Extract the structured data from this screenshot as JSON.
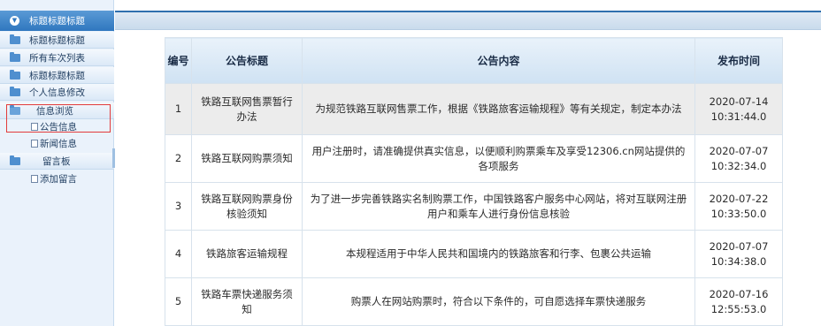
{
  "sidebar": {
    "header_label": "标题标题标题",
    "items": [
      {
        "label": "标题标题标题"
      },
      {
        "label": "所有车次列表"
      },
      {
        "label": "标题标题标题"
      },
      {
        "label": "个人信息修改"
      },
      {
        "label": "信息浏览"
      }
    ],
    "info_sub": [
      {
        "label": "公告信息"
      },
      {
        "label": "新闻信息"
      }
    ],
    "msg_folder": {
      "label": "留言板"
    },
    "msg_sub": [
      {
        "label": "添加留言"
      }
    ]
  },
  "table": {
    "headers": [
      "编号",
      "公告标题",
      "公告内容",
      "发布时间"
    ],
    "rows": [
      {
        "id": "1",
        "title": "铁路互联网售票暂行办法",
        "content": "为规范铁路互联网售票工作，根据《铁路旅客运输规程》等有关规定，制定本办法",
        "time": "2020-07-14 10:31:44.0"
      },
      {
        "id": "2",
        "title": "铁路互联网购票须知",
        "content": "用户注册时，请准确提供真实信息，以便顺利购票乘车及享受12306.cn网站提供的各项服务",
        "time": "2020-07-07 10:32:34.0"
      },
      {
        "id": "3",
        "title": "铁路互联网购票身份核验须知",
        "content": "为了进一步完善铁路实名制购票工作，中国铁路客户服务中心网站，将对互联网注册用户和乘车人进行身份信息核验",
        "time": "2020-07-22 10:33:50.0"
      },
      {
        "id": "4",
        "title": "铁路旅客运输规程",
        "content": "本规程适用于中华人民共和国境内的铁路旅客和行李、包裹公共运输",
        "time": "2020-07-07 10:34:38.0"
      },
      {
        "id": "5",
        "title": "铁路车票快递服务须知",
        "content": "购票人在网站购票时，符合以下条件的，可自愿选择车票快递服务",
        "time": "2020-07-16 12:55:53.0"
      }
    ]
  },
  "colors": {
    "accent": "#2f77bf",
    "highlight": "#e23b3b"
  }
}
